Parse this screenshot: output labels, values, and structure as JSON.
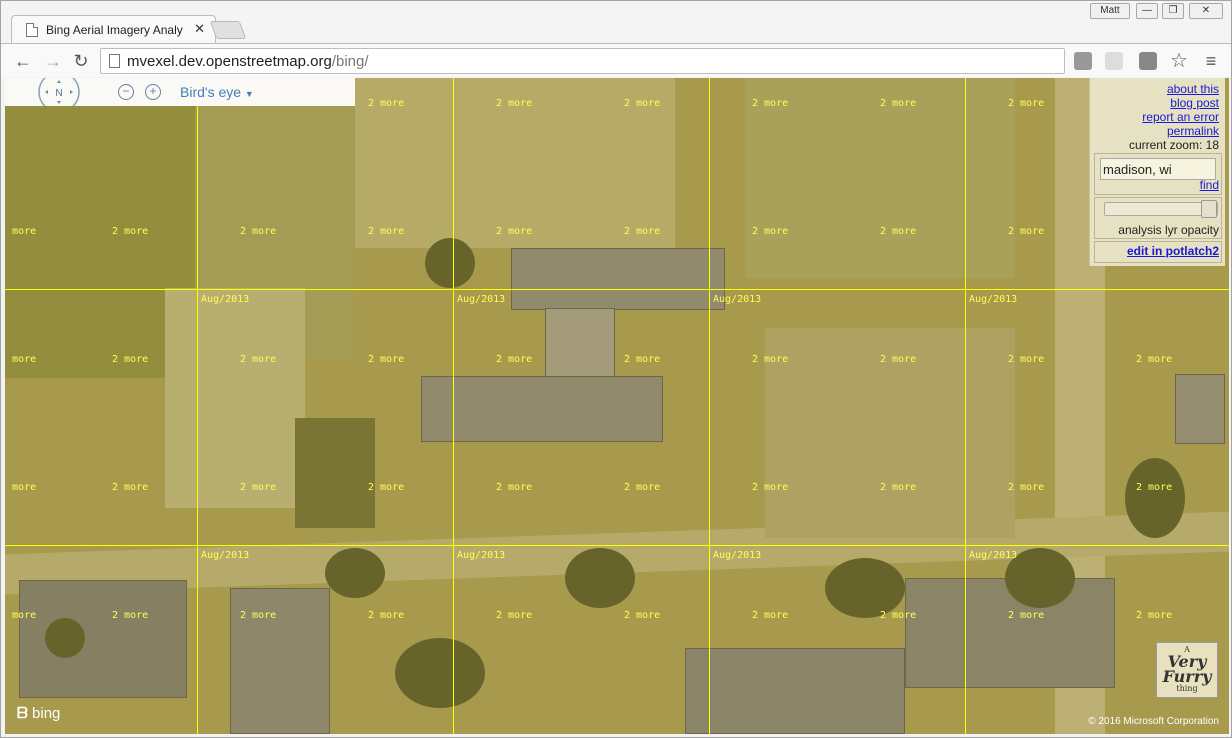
{
  "browser": {
    "tab_title": "Bing Aerial Imagery Analy",
    "profile_name": "Matt",
    "url_host": "mvexel.dev.openstreetmap.org",
    "url_path": "/bing/"
  },
  "map_controls": {
    "compass_label": "N",
    "view_mode": "Bird's eye"
  },
  "panel": {
    "about": "about this",
    "blog": "blog post",
    "report": "report an error",
    "permalink": "permalink",
    "zoom_text": "current zoom: 18",
    "search_value": "madison, wi",
    "find": "find",
    "opacity_label": "analysis lyr opacity",
    "opacity_level": 1.0,
    "edit": "edit in potlatch2"
  },
  "tile_labels": {
    "more": "2 more",
    "date": "Aug/2013"
  },
  "attribution": {
    "logo": "bing",
    "copyright": "© 2016 Microsoft Corporation"
  },
  "badge": {
    "line1": "A",
    "line2": "Very",
    "line3": "Furry",
    "line4": "thing"
  },
  "colors": {
    "grid": "#ffff00",
    "overlay": "#a79a4d",
    "link": "#1a1ad6",
    "birdseye": "#3f7cc0"
  }
}
